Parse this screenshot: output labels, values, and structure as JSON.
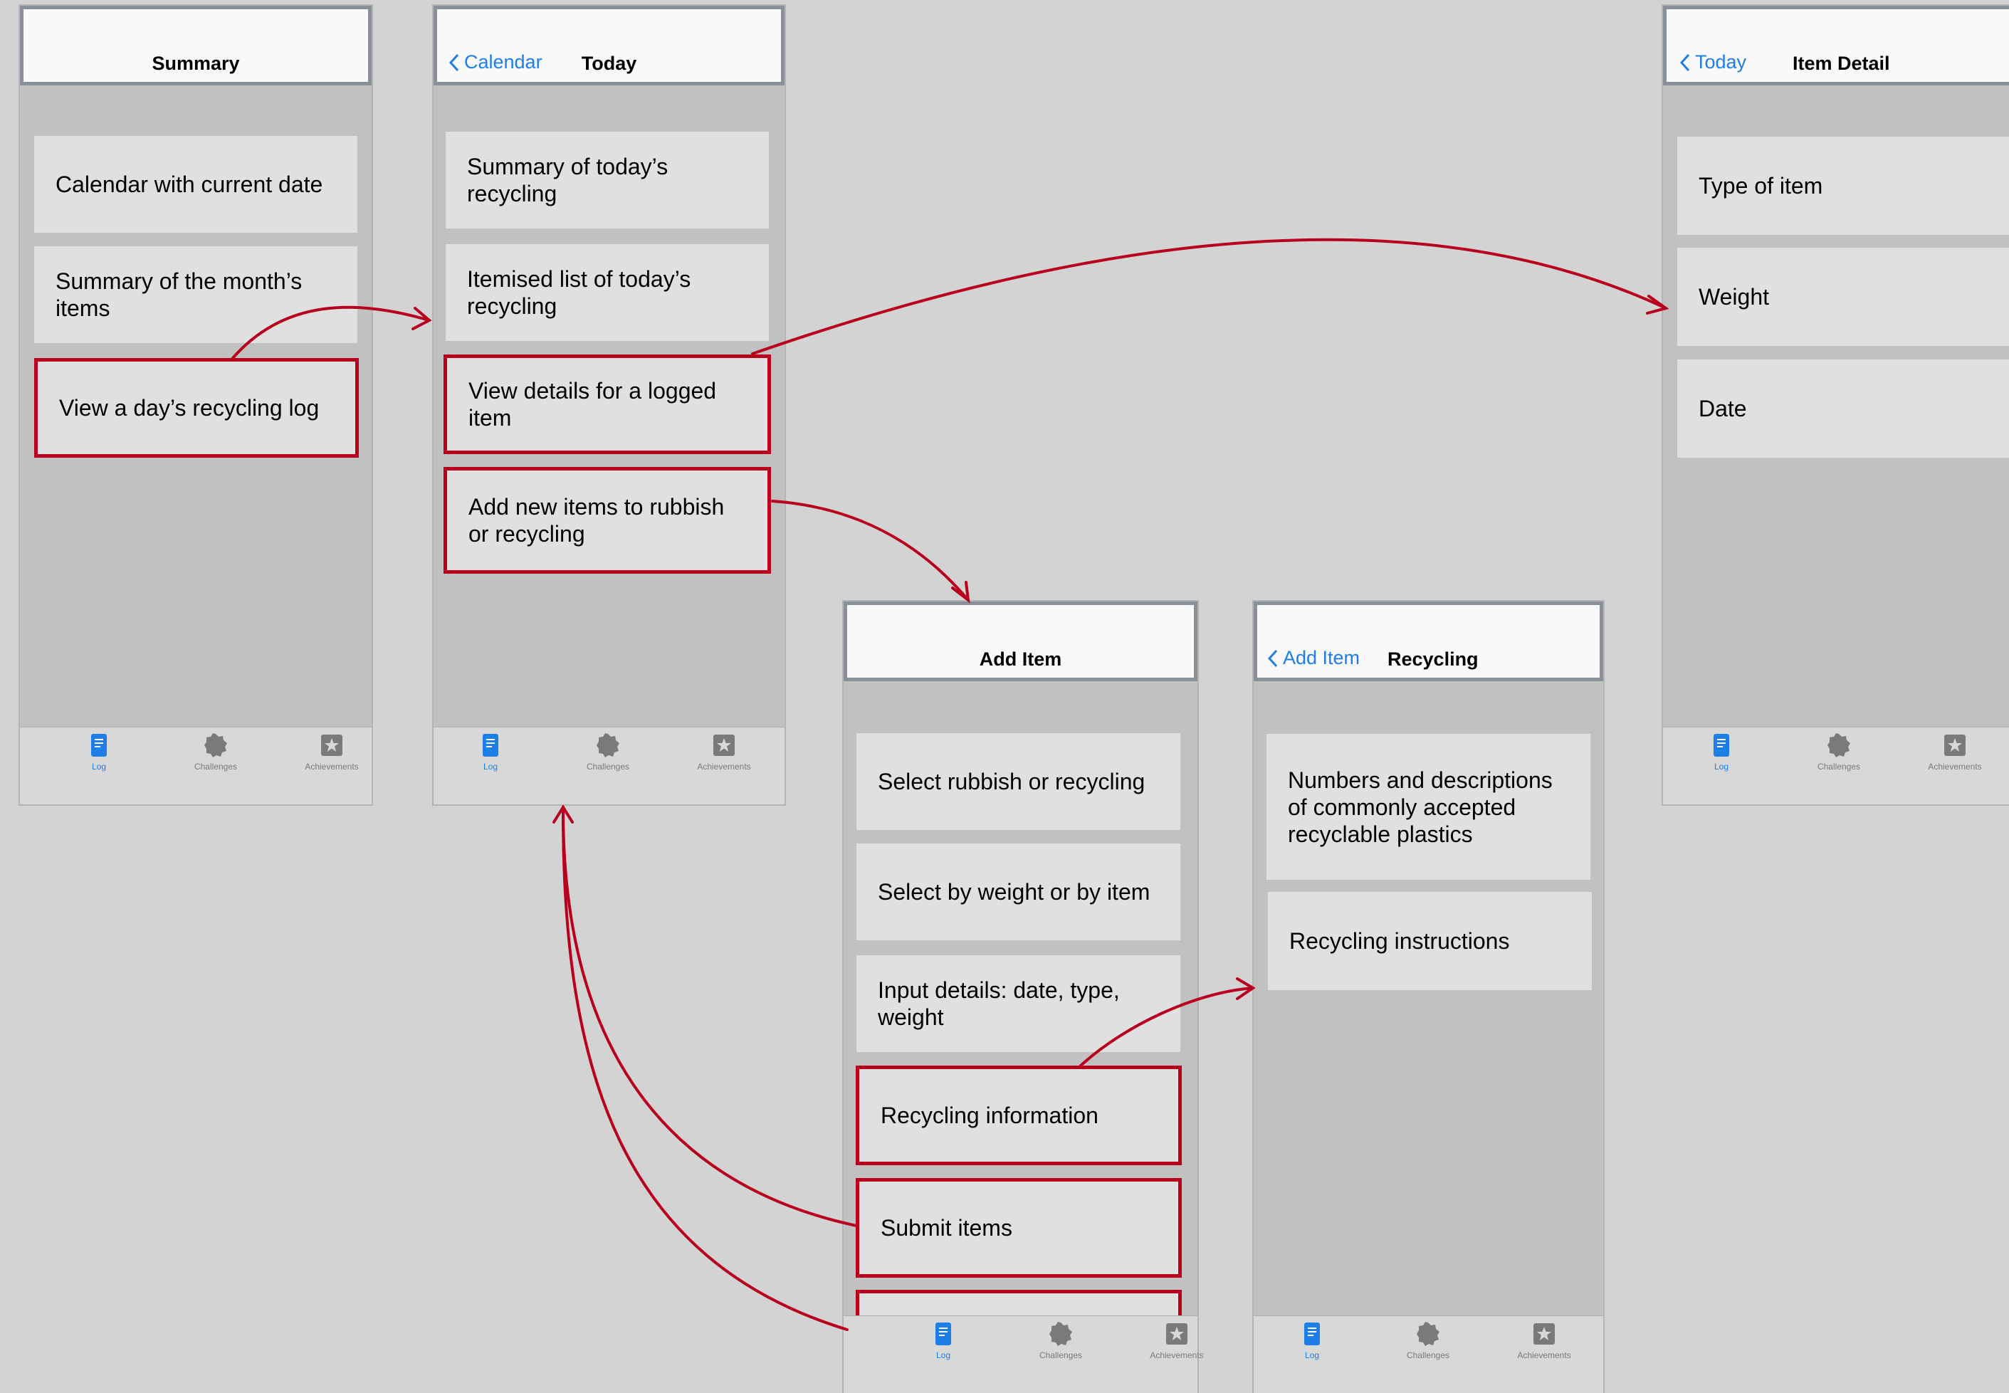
{
  "colors": {
    "accent": "#1e7ee8",
    "highlight": "#b8001e"
  },
  "tabs": {
    "log": "Log",
    "challenges": "Challenges",
    "achievements": "Achievements"
  },
  "screens": {
    "summary": {
      "title": "Summary",
      "cards": [
        "Calendar with current date",
        "Summary of the month’s items",
        "View a day’s recycling log"
      ]
    },
    "today": {
      "back": "Calendar",
      "title": "Today",
      "cards": [
        "Summary of today’s recycling",
        "Itemised list of today’s recycling",
        "View details for a logged item",
        "Add new items to rubbish or recycling"
      ]
    },
    "add_item": {
      "title": "Add Item",
      "cards": [
        "Select rubbish or recycling",
        "Select by weight or by item",
        "Input details: date, type, weight",
        "Recycling information",
        "Submit items"
      ]
    },
    "recycling": {
      "back": "Add Item",
      "title": "Recycling",
      "cards": [
        "Numbers and descriptions of commonly accepted recyclable plastics",
        "Recycling instructions"
      ]
    },
    "item_detail": {
      "back": "Today",
      "title": "Item Detail",
      "cards": [
        "Type of item",
        "Weight",
        "Date"
      ]
    }
  }
}
